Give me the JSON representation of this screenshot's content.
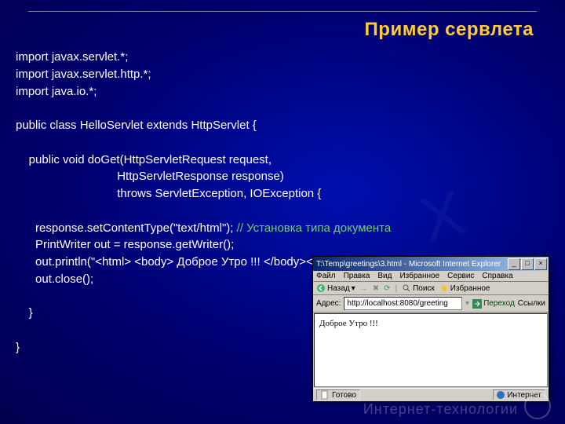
{
  "slide": {
    "title": "Пример сервлета",
    "footer": "Интернет-технологии"
  },
  "code": {
    "l1": "import javax.servlet.*;",
    "l2": "import javax.servlet.http.*;",
    "l3": "import java.io.*;",
    "l4": "",
    "l5": "public class HelloServlet extends HttpServlet {",
    "l6": "",
    "l7": "    public void doGet(HttpServletRequest request,",
    "l8": "                               HttpServletResponse response)",
    "l9": "                               throws ServletException, IOException {",
    "l10": "",
    "l11a": "      response.setContentType(\"text/html\"); ",
    "l11b": "// Установка типа документа",
    "l12": "      PrintWriter out = response.getWriter();",
    "l13": "      out.println(\"<html> <body> Доброе Утро !!! </body></html> \");",
    "l14": "      out.close();",
    "l15": "",
    "l16": "    }",
    "l17": "",
    "l18": "}"
  },
  "browser": {
    "title": "T:\\Temp\\greetings\\3.html - Microsoft Internet Explorer",
    "menu": [
      "Файл",
      "Правка",
      "Вид",
      "Избранное",
      "Сервис",
      "Справка"
    ],
    "toolbar": {
      "back": "Назад",
      "search": "Поиск",
      "favorites": "Избранное"
    },
    "address_label": "Адрес:",
    "url": "http://localhost:8080/greeting",
    "go": "Переход",
    "links": "Ссылки",
    "page_text": "Доброе Утро !!!",
    "status_left": "Готово",
    "status_right": "Интернет"
  }
}
